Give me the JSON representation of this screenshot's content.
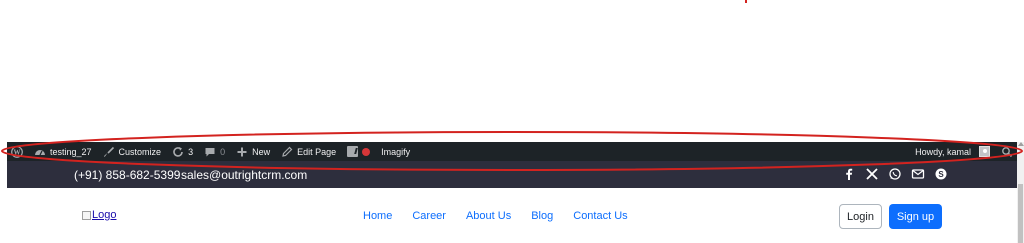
{
  "admin_bar": {
    "site_name": "testing_27",
    "customize_label": "Customize",
    "updates_count": "3",
    "comments_count": "0",
    "new_label": "New",
    "edit_page_label": "Edit Page",
    "imagify_label": "Imagify",
    "greeting": "Howdy, kamal"
  },
  "topbar": {
    "phone": "(+91) 858-682-5399",
    "email": "sales@outrightcrm.com",
    "social_icons": [
      "facebook-icon",
      "x-icon",
      "whatsapp-icon",
      "mail-icon",
      "skype-icon"
    ]
  },
  "navbar": {
    "logo_alt": "Logo",
    "links": [
      "Home",
      "Career",
      "About Us",
      "Blog",
      "Contact Us"
    ],
    "login_label": "Login",
    "signup_label": "Sign up"
  },
  "colors": {
    "admin_bar_bg": "#1d2327",
    "topbar_bg": "#2d2e3d",
    "link_blue": "#0d6efd",
    "annotation_red": "#d3231f"
  }
}
